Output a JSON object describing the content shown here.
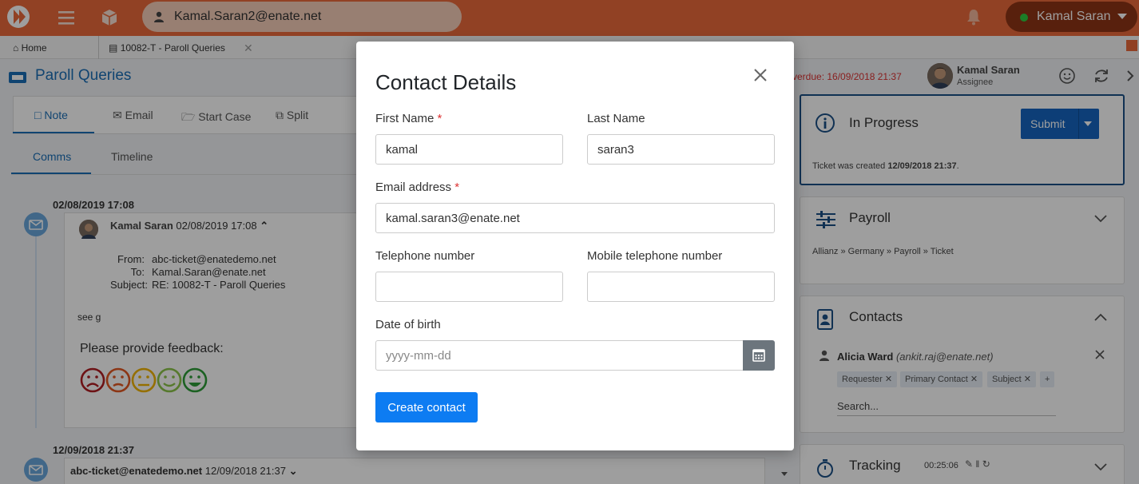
{
  "topbar": {
    "search_value": "Kamal.Saran2@enate.net",
    "user_name": "Kamal Saran",
    "accent": "#ea6a3a"
  },
  "tabs": [
    {
      "label": "Home",
      "icon": "home-icon"
    },
    {
      "label": "10082-T - Paroll Queries",
      "icon": "ticket-icon"
    }
  ],
  "page": {
    "title": "Paroll Queries",
    "overdue": "verdue: 16/09/2018 21:37",
    "assignee_name": "Kamal Saran",
    "assignee_role": "Assignee"
  },
  "toolbar": {
    "note": "Note",
    "email": "Email",
    "start_case": "Start Case",
    "split": "Split"
  },
  "subtabs": {
    "comms": "Comms",
    "timeline": "Timeline"
  },
  "timeline": {
    "entry1": {
      "date": "02/08/2019 17:08",
      "sender": "Kamal Saran",
      "sent_time": "02/08/2019 17:08",
      "from_k": "From:",
      "from_v": "abc-ticket@enatedemo.net",
      "to_k": "To:",
      "to_v": "Kamal.Saran@enate.net",
      "subject_k": "Subject:",
      "subject_v": "RE: 10082-T - Paroll Queries",
      "body": "see g",
      "feedback": "Please provide feedback:"
    },
    "entry2": {
      "date": "12/09/2018 21:37",
      "sender": "abc-ticket@enatedemo.net",
      "sent_time": "12/09/2018 21:37"
    }
  },
  "status": {
    "title": "In Progress",
    "submit": "Submit",
    "created_prefix": "Ticket was created",
    "created_date": "12/09/2018 21:37",
    "created_suffix": "."
  },
  "payroll": {
    "title": "Payroll",
    "breadcrumb": "Allianz » Germany » Payroll » Ticket"
  },
  "contacts": {
    "title": "Contacts",
    "name": "Alicia Ward",
    "email": "(ankit.raj@enate.net)",
    "chips": [
      "Requester",
      "Primary Contact",
      "Subject"
    ],
    "search_placeholder": "Search..."
  },
  "tracking": {
    "title": "Tracking",
    "time": "00:25:06"
  },
  "modal": {
    "title": "Contact Details",
    "first_name_label": "First Name",
    "first_name_value": "kamal",
    "last_name_label": "Last Name",
    "last_name_value": "saran3",
    "email_label": "Email address",
    "email_value": "kamal.saran3@enate.net",
    "tel_label": "Telephone number",
    "tel_value": "",
    "mobile_label": "Mobile telephone number",
    "mobile_value": "",
    "dob_label": "Date of birth",
    "dob_placeholder": "yyyy-mm-dd",
    "required_mark": "*",
    "create_button": "Create contact"
  }
}
